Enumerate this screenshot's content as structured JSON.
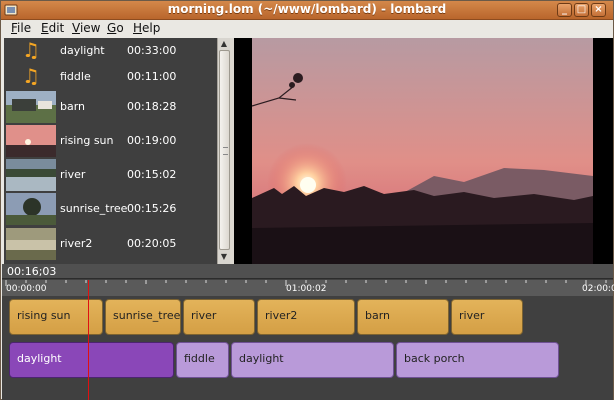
{
  "window": {
    "title": "morning.lom (~/www/lombard) - lombard",
    "controls": {
      "minimize": "_",
      "maximize": "□",
      "close": "×"
    }
  },
  "menu": {
    "items": [
      {
        "label": "File",
        "ul": "F",
        "rest": "ile"
      },
      {
        "label": "Edit",
        "ul": "E",
        "rest": "dit"
      },
      {
        "label": "View",
        "ul": "V",
        "rest": "iew"
      },
      {
        "label": "Go",
        "ul": "G",
        "rest": "o"
      },
      {
        "label": "Help",
        "ul": "H",
        "rest": "elp"
      }
    ]
  },
  "library": {
    "items": [
      {
        "name": "daylight",
        "duration": "00:33:00",
        "kind": "audio",
        "icon": "music-note-icon"
      },
      {
        "name": "fiddle",
        "duration": "00:11:00",
        "kind": "audio",
        "icon": "music-note-icon"
      },
      {
        "name": "barn",
        "duration": "00:18:28",
        "kind": "video"
      },
      {
        "name": "rising sun",
        "duration": "00:19:00",
        "kind": "video"
      },
      {
        "name": "river",
        "duration": "00:15:02",
        "kind": "video"
      },
      {
        "name": "sunrise_tree",
        "duration": "00:15:26",
        "kind": "video"
      },
      {
        "name": "river2",
        "duration": "00:20:05",
        "kind": "video"
      }
    ]
  },
  "timeline": {
    "timecode": "00:16;03",
    "ruler_labels": [
      "00:00:00",
      "01:00:02",
      "02:00:0"
    ],
    "video_track": [
      "rising sun",
      "sunrise_tree",
      "river",
      "river2",
      "barn",
      "river"
    ],
    "audio_track": [
      "daylight",
      "fiddle",
      "daylight",
      "back porch"
    ]
  },
  "colors": {
    "accent": "#c87838",
    "video_clip": "#dfae55",
    "audio_clip": "#b99ad9",
    "audio_selected": "#8a47b8",
    "playhead": "#e01010"
  }
}
